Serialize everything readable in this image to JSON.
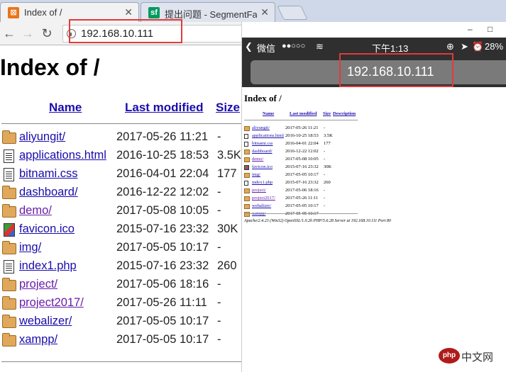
{
  "browser": {
    "tabs": [
      {
        "title": "Index of /",
        "favicon_color": "#e8751a",
        "favicon_glyph": "⊠"
      },
      {
        "title": "提出问题 - SegmentFau",
        "favicon_color": "#009a61",
        "favicon_glyph": "sf"
      }
    ],
    "address": "192.168.10.111"
  },
  "page": {
    "heading": "Index of /",
    "columns": {
      "name": "Name",
      "modified": "Last modified",
      "size": "Size"
    },
    "rows": [
      {
        "name": "aliyungit/",
        "date": "2017-05-26 11:21",
        "size": "-",
        "icon": "folder-icon",
        "visited": false
      },
      {
        "name": "applications.html",
        "date": "2016-10-25 18:53",
        "size": "3.5K",
        "icon": "document-icon",
        "visited": false
      },
      {
        "name": "bitnami.css",
        "date": "2016-04-01 22:04",
        "size": "177",
        "icon": "document-icon",
        "visited": false
      },
      {
        "name": "dashboard/",
        "date": "2016-12-22 12:02",
        "size": "-",
        "icon": "folder-icon",
        "visited": false
      },
      {
        "name": "demo/",
        "date": "2017-05-08 10:05",
        "size": "-",
        "icon": "folder-icon",
        "visited": true
      },
      {
        "name": "favicon.ico",
        "date": "2015-07-16 23:32",
        "size": "30K",
        "icon": "image-icon",
        "visited": false
      },
      {
        "name": "img/",
        "date": "2017-05-05 10:17",
        "size": "-",
        "icon": "folder-icon",
        "visited": false
      },
      {
        "name": "index1.php",
        "date": "2015-07-16 23:32",
        "size": "260",
        "icon": "document-icon",
        "visited": false
      },
      {
        "name": "project/",
        "date": "2017-05-06 18:16",
        "size": "-",
        "icon": "folder-icon",
        "visited": true
      },
      {
        "name": "project2017/",
        "date": "2017-05-26 11:11",
        "size": "-",
        "icon": "folder-icon",
        "visited": true
      },
      {
        "name": "webalizer/",
        "date": "2017-05-05 10:17",
        "size": "-",
        "icon": "folder-icon",
        "visited": false
      },
      {
        "name": "xampp/",
        "date": "2017-05-05 10:17",
        "size": "-",
        "icon": "folder-icon",
        "visited": false
      }
    ]
  },
  "phone": {
    "window_controls": {
      "minimize": "–",
      "maximize": "□"
    },
    "status": {
      "carrier": "微信",
      "signal": "●●○○○",
      "time": "下午1:13",
      "battery": "28%"
    },
    "address": "192.168.10.111",
    "heading": "Index of /",
    "columns": {
      "name": "Name",
      "modified": "Last modified",
      "size": "Size",
      "description": "Description"
    },
    "footer": "Apache/2.4.23 (Win32) OpenSSL/1.0.2h PHP/5.6.28 Server at 192.168.10.111 Port 80"
  },
  "watermark": {
    "logo": "php",
    "text": "中文网"
  },
  "colors": {
    "highlight_box": "#e23a3a",
    "link": "#1a0dab",
    "visited": "#681da8",
    "folder": "#e0a85a"
  }
}
